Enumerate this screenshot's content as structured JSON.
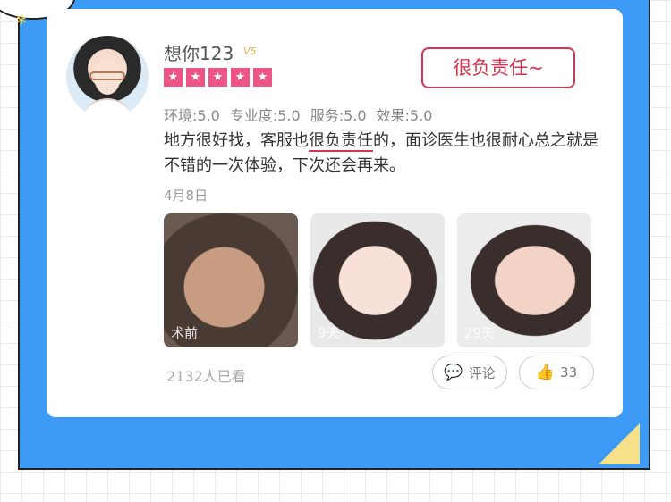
{
  "user": {
    "name": "想你123",
    "badge": "V5"
  },
  "rating": {
    "stars": 5
  },
  "tag": {
    "label": "很负责任~"
  },
  "scores": [
    {
      "label": "环境:5.0"
    },
    {
      "label": "专业度:5.0"
    },
    {
      "label": "服务:5.0"
    },
    {
      "label": "效果:5.0"
    }
  ],
  "review": {
    "part1": "地方很好找，客服也",
    "highlight": "很负责任",
    "part2": "的，面诊医生也很耐心总之就是不错的一次体验，下次还会再来。"
  },
  "date": "4月8日",
  "photos": [
    {
      "caption": "术前"
    },
    {
      "caption": "9天"
    },
    {
      "caption": "29天"
    }
  ],
  "footer": {
    "views": "2132人已看",
    "comment_label": "评论",
    "like_count": "33"
  },
  "colors": {
    "accent": "#d9334f",
    "frame": "#3d9bf5",
    "star": "#ec5585"
  },
  "icons": {
    "comment": "speech-bubble-icon",
    "like": "thumbs-up-icon"
  }
}
